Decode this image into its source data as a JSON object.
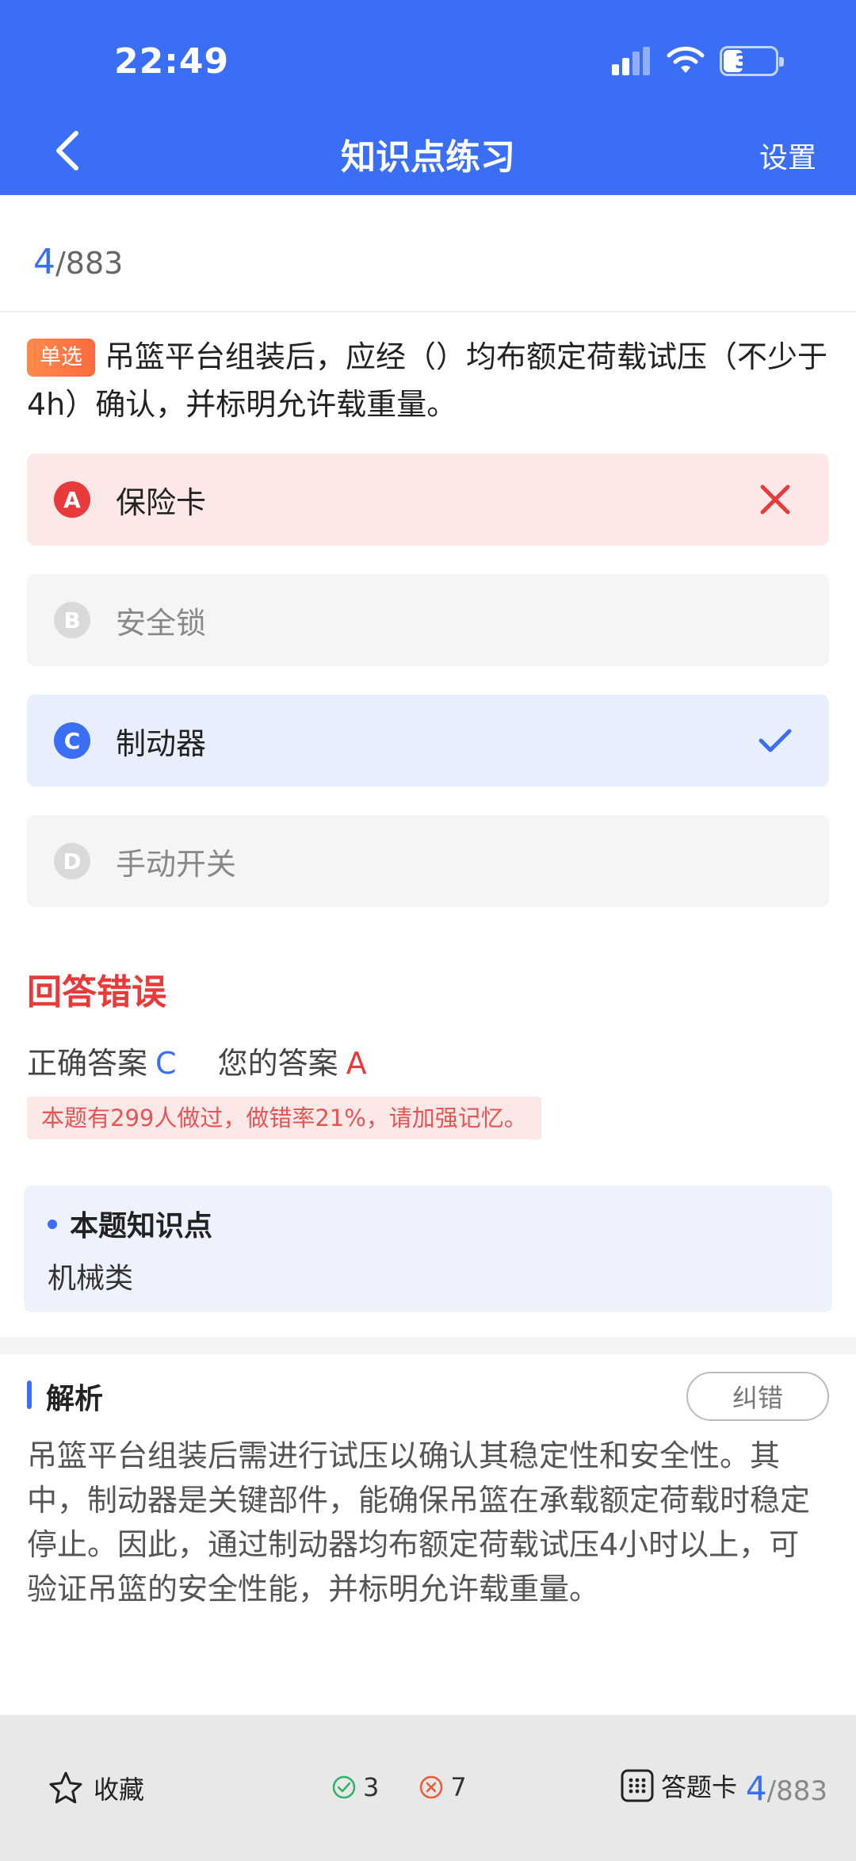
{
  "status": {
    "time": "22:49",
    "battery": "35"
  },
  "nav": {
    "title": "知识点练习",
    "settings": "设置"
  },
  "progress": {
    "current": "4",
    "total": "/883"
  },
  "question": {
    "type": "单选",
    "text": "吊篮平台组装后，应经（）均布额定荷载试压（不少于4h）确认，并标明允许载重量。"
  },
  "options": [
    {
      "letter": "A",
      "text": "保险卡",
      "state": "wrong"
    },
    {
      "letter": "B",
      "text": "安全锁",
      "state": "normal"
    },
    {
      "letter": "C",
      "text": "制动器",
      "state": "correct"
    },
    {
      "letter": "D",
      "text": "手动开关",
      "state": "normal"
    }
  ],
  "result": {
    "title": "回答错误",
    "correct_label": "正确答案",
    "correct_value": "C",
    "your_label": "您的答案",
    "your_value": "A",
    "note": "本题有299人做过，做错率21%，请加强记忆。"
  },
  "knowledge": {
    "title": "本题知识点",
    "value": "机械类"
  },
  "analysis": {
    "title": "解析",
    "report": "纠错",
    "text": "吊篮平台组装后需进行试压以确认其稳定性和安全性。其中，制动器是关键部件，能确保吊篮在承载额定荷载时稳定停止。因此，通过制动器均布额定荷载试压4小时以上，可验证吊篮的安全性能，并标明允许载重量。"
  },
  "bottom": {
    "favorite": "收藏",
    "correct_count": "3",
    "wrong_count": "7",
    "answer_card": "答题卡",
    "progress_current": "4",
    "progress_total": "/883"
  },
  "colors": {
    "primary": "#3a6ef5",
    "error": "#e83a3a",
    "badge": "#ff7a45"
  }
}
